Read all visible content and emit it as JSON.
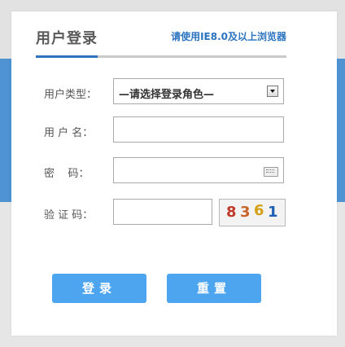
{
  "header": {
    "title": "用户登录",
    "hint": "请使用IE8.0及以上浏览器"
  },
  "form": {
    "role_label": "用户类型：",
    "role_selected": "—请选择登录角色—",
    "username_label": "用 户 名：",
    "username_value": "",
    "password_label": "密    码：",
    "password_value": "",
    "captcha_label": "验 证 码：",
    "captcha_value": "",
    "captcha_digits": [
      "8",
      "3",
      "6",
      "1"
    ]
  },
  "buttons": {
    "login": "登录",
    "reset": "重置"
  },
  "colors": {
    "accent": "#2f73bf",
    "button": "#4da5f0",
    "band": "#4f93d3"
  }
}
